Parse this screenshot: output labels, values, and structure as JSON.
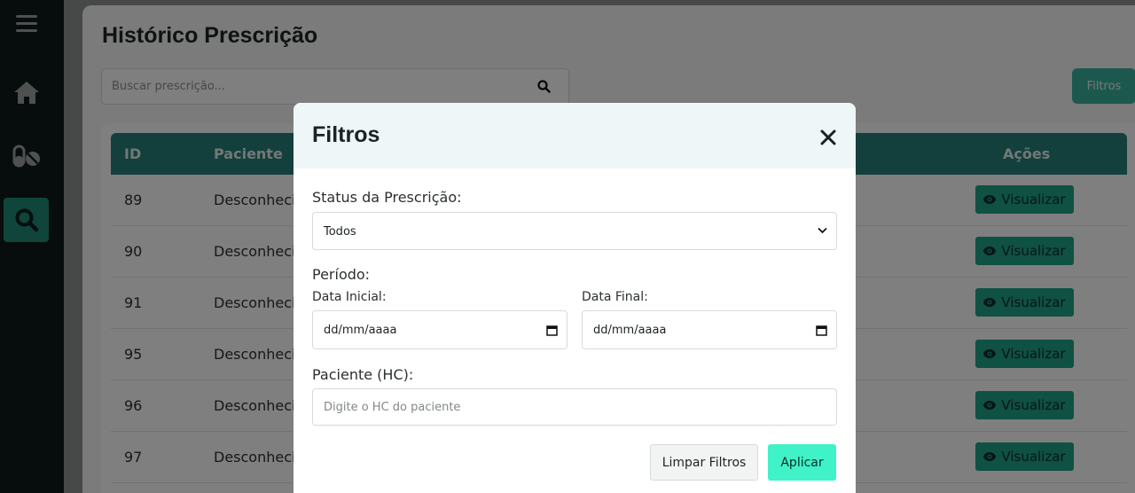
{
  "sidebar": {
    "items": [
      {
        "icon": "hamburger-menu-icon"
      },
      {
        "icon": "home-icon"
      },
      {
        "icon": "pills-icon"
      },
      {
        "icon": "search-icon",
        "active": true
      }
    ]
  },
  "page": {
    "title": "Histórico Prescrição",
    "search_placeholder": "Buscar prescrição...",
    "filters_button": "Filtros"
  },
  "table": {
    "columns": [
      "ID",
      "Paciente",
      "Ações"
    ],
    "rows": [
      {
        "id": "89",
        "paciente": "Desconheci",
        "action": "Visualizar"
      },
      {
        "id": "90",
        "paciente": "Desconheci",
        "action": "Visualizar"
      },
      {
        "id": "91",
        "paciente": "Desconheci",
        "action": "Visualizar"
      },
      {
        "id": "95",
        "paciente": "Desconheci",
        "action": "Visualizar"
      },
      {
        "id": "96",
        "paciente": "Desconheci",
        "action": "Visualizar"
      },
      {
        "id": "97",
        "paciente": "Desconheci",
        "action": "Visualizar"
      }
    ]
  },
  "modal": {
    "title": "Filtros",
    "status_label": "Status da Prescrição:",
    "status_value": "Todos",
    "period_label": "Período:",
    "start_label": "Data Inicial:",
    "start_value": "dd/mm/aaaa",
    "end_label": "Data Final:",
    "end_value": "dd/mm/aaaa",
    "patient_label": "Paciente (HC):",
    "patient_placeholder": "Digite o HC do paciente",
    "clear_button": "Limpar Filtros",
    "apply_button": "Aplicar"
  },
  "colors": {
    "sidebar_bg": "#0f1819",
    "accent": "#1f8a75",
    "table_header": "#27817a",
    "apply_button": "#3ff2c7"
  }
}
